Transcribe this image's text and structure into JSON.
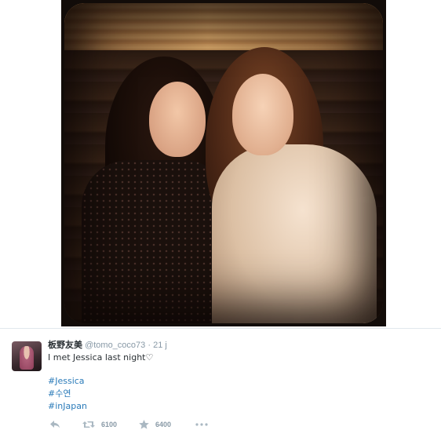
{
  "tweet": {
    "display_name": "板野友美",
    "handle": "@tomo_coco73",
    "separator": "·",
    "time": "21 j",
    "text": "I met Jessica last night♡",
    "hashtags": [
      "#Jessica",
      "#수연",
      "#inJapan"
    ],
    "actions": {
      "reply_icon": "reply-icon",
      "retweet_icon": "retweet-icon",
      "retweet_count": "6100",
      "favorite_icon": "star-icon",
      "favorite_count": "6400",
      "more_icon": "more-dots-icon"
    }
  },
  "colors": {
    "link": "#2b7bb9",
    "muted": "#8899a6",
    "text": "#292f33",
    "icon": "#aab8c2"
  }
}
